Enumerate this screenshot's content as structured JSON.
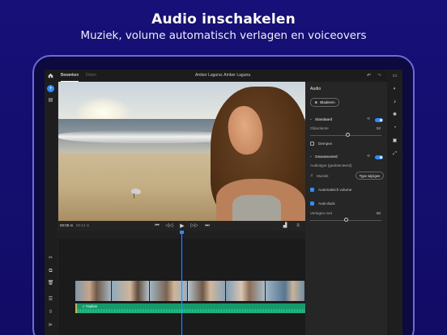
{
  "promo": {
    "headline": "Audio inschakelen",
    "subline": "Muziek, volume automatisch verlagen en voiceovers"
  },
  "app": {
    "tabs": [
      {
        "label": "Bewerken",
        "active": true
      },
      {
        "label": "Delen",
        "active": false
      }
    ],
    "project_title": "Amber Laguna: Amber Laguna"
  },
  "player": {
    "current_time": "00:09 m",
    "total_time": "00:14 m"
  },
  "audio_panel": {
    "title": "Audio",
    "browse_label": "Bladeren",
    "standard": {
      "label": "Standaard",
      "enabled": true,
      "clip_volume_label": "Clipvolume",
      "clip_volume_value": "52",
      "mute_label": "Dempen",
      "mute_checked": false
    },
    "advanced": {
      "label": "Geavanceerd",
      "enabled": true,
      "audio_type_label": "Audiotype (gedetecteerd)",
      "audio_type_value": "Muziek",
      "change_type_label": "Type wijzigen",
      "auto_volume_label": "Automatisch volume",
      "auto_volume_checked": true,
      "auto_duck_label": "Auto-duck",
      "auto_duck_checked": true,
      "duck_amount_label": "Verlagen met",
      "duck_amount_value": "50"
    }
  },
  "timeline": {
    "audio_clip_label": "Yaybox"
  },
  "colors": {
    "background": "#140f6e",
    "accent": "#2f8cff",
    "audio_track": "#159a6b",
    "audio_marker": "#f0a030"
  }
}
